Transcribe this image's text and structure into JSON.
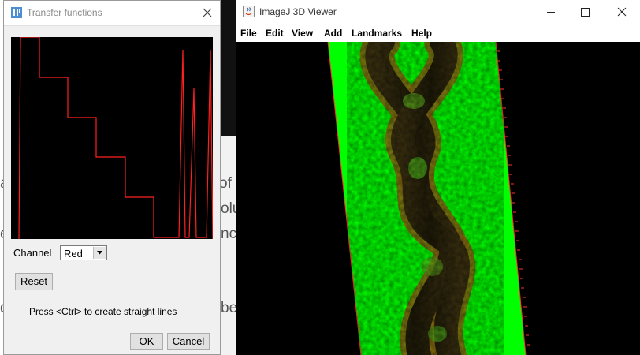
{
  "background": {
    "fragments": [
      "a",
      "e",
      "d",
      "of p",
      "olu",
      "nc",
      "be"
    ]
  },
  "transfer_dialog": {
    "title": "Transfer functions",
    "channel_label": "Channel",
    "channel_value": "Red",
    "channel_options": [
      "Red"
    ],
    "reset_label": "Reset",
    "hint": "Press <Ctrl> to create straight lines",
    "ok_label": "OK",
    "cancel_label": "Cancel",
    "curve_color": "#ff2020"
  },
  "viewer": {
    "title": "ImageJ 3D Viewer",
    "menu": [
      "File",
      "Edit",
      "View",
      "Add",
      "Landmarks",
      "Help"
    ],
    "bounding_box_color": "#00ff00",
    "volume_content": "double-helix-structure"
  }
}
